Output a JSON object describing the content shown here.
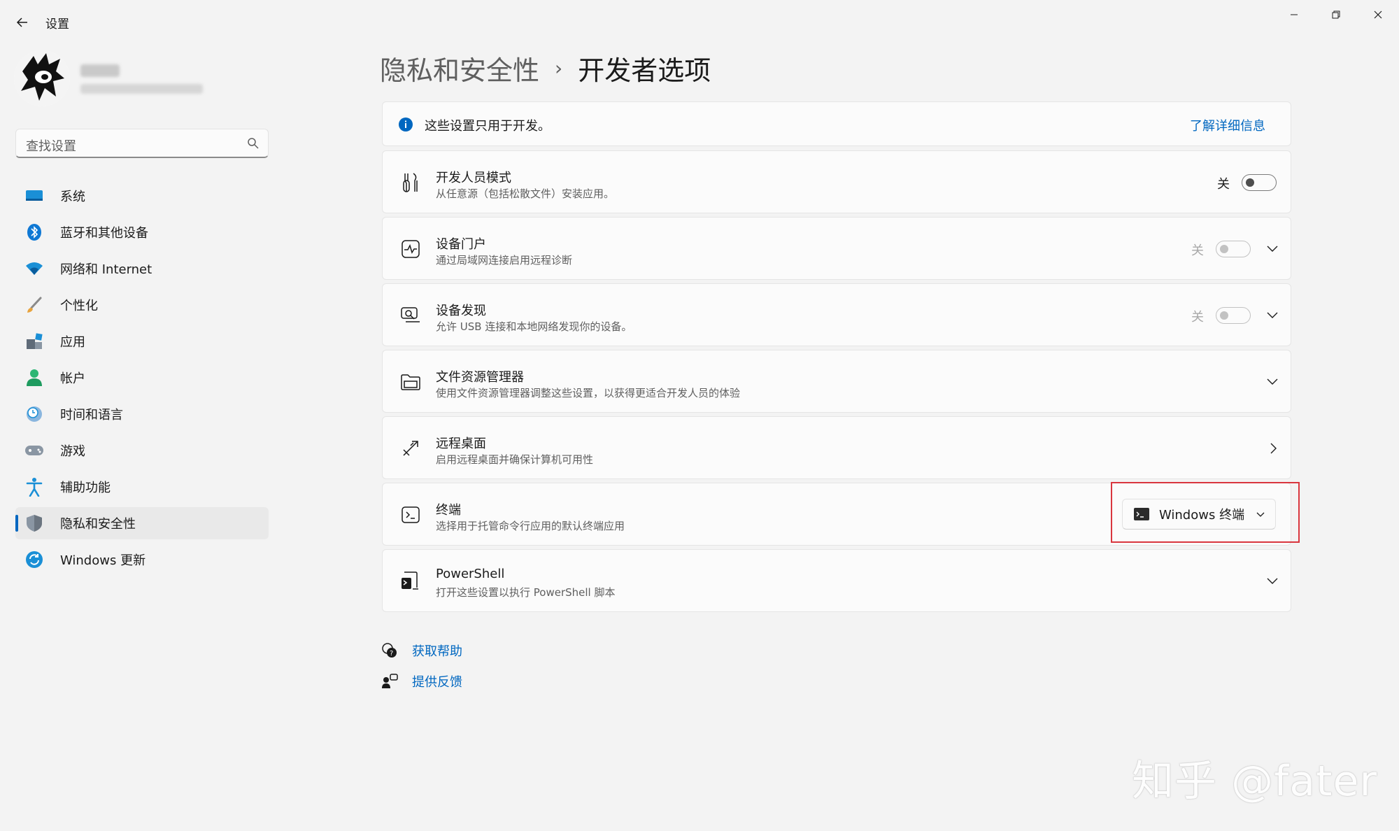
{
  "app": {
    "title": "设置"
  },
  "sidebar": {
    "search_placeholder": "查找设置",
    "items": [
      {
        "label": "系统",
        "icon": "monitor-icon"
      },
      {
        "label": "蓝牙和其他设备",
        "icon": "bluetooth-icon"
      },
      {
        "label": "网络和 Internet",
        "icon": "wifi-icon"
      },
      {
        "label": "个性化",
        "icon": "brush-icon"
      },
      {
        "label": "应用",
        "icon": "apps-icon"
      },
      {
        "label": "帐户",
        "icon": "account-icon"
      },
      {
        "label": "时间和语言",
        "icon": "clock-globe-icon"
      },
      {
        "label": "游戏",
        "icon": "gamepad-icon"
      },
      {
        "label": "辅助功能",
        "icon": "accessibility-icon"
      },
      {
        "label": "隐私和安全性",
        "icon": "shield-icon",
        "active": true
      },
      {
        "label": "Windows 更新",
        "icon": "windows-update-icon"
      }
    ]
  },
  "header": {
    "parent": "隐私和安全性",
    "separator": "›",
    "current": "开发者选项"
  },
  "info_bar": {
    "text": "这些设置只用于开发。",
    "link": "了解详细信息"
  },
  "settings": [
    {
      "title": "开发人员模式",
      "desc": "从任意源（包括松散文件）安装应用。",
      "state": "关",
      "icon": "dev-tools-icon"
    },
    {
      "title": "设备门户",
      "desc": "通过局域网连接启用远程诊断",
      "state": "关",
      "icon": "pulse-icon"
    },
    {
      "title": "设备发现",
      "desc": "允许 USB 连接和本地网络发现你的设备。",
      "state": "关",
      "icon": "device-discovery-icon"
    },
    {
      "title": "文件资源管理器",
      "desc": "使用文件资源管理器调整这些设置，以获得更适合开发人员的体验",
      "icon": "folder-icon"
    },
    {
      "title": "远程桌面",
      "desc": "启用远程桌面并确保计算机可用性",
      "icon": "remote-desktop-icon"
    },
    {
      "title": "终端",
      "desc": "选择用于托管命令行应用的默认终端应用",
      "icon": "terminal-icon",
      "dropdown_value": "Windows 终端"
    },
    {
      "title": "PowerShell",
      "desc": "打开这些设置以执行 PowerShell 脚本",
      "icon": "powershell-icon"
    }
  ],
  "help": {
    "get_help": "获取帮助",
    "feedback": "提供反馈"
  },
  "watermark": "知乎 @fater",
  "colors": {
    "accent": "#0067c0",
    "highlight": "#d9363e",
    "background": "#f3f3f3",
    "card": "#fbfbfb"
  }
}
